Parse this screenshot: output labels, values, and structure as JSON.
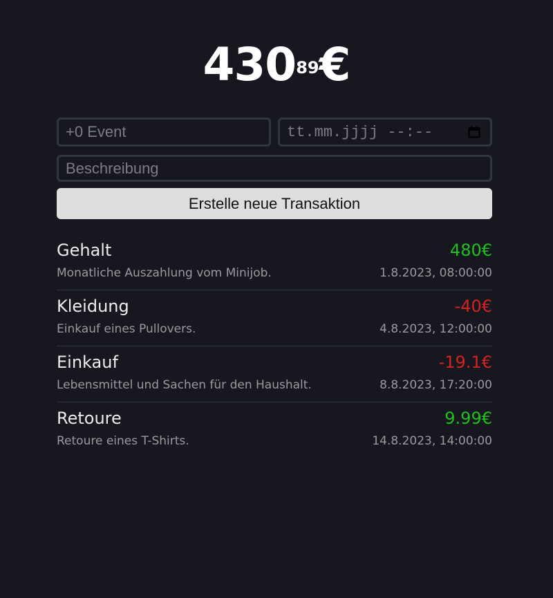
{
  "balance": {
    "whole": "430",
    "cents": "89",
    "currency": "€"
  },
  "form": {
    "amount_placeholder": "+0 Event",
    "date_placeholder": "tt.mm.jjjj --:--",
    "description_placeholder": "Beschreibung",
    "submit_label": "Erstelle neue Transaktion",
    "date_icon": "calendar-icon"
  },
  "colors": {
    "background": "#17181f",
    "positive": "#20c020",
    "negative": "#d42222",
    "button": "#dedede"
  },
  "transactions": [
    {
      "title": "Gehalt",
      "amount": "480€",
      "sign": "positive",
      "description": "Monatliche Auszahlung vom Minijob.",
      "date": "1.8.2023, 08:00:00"
    },
    {
      "title": "Kleidung",
      "amount": "-40€",
      "sign": "negative",
      "description": "Einkauf eines Pullovers.",
      "date": "4.8.2023, 12:00:00"
    },
    {
      "title": "Einkauf",
      "amount": "-19.1€",
      "sign": "negative",
      "description": "Lebensmittel und Sachen für den Haushalt.",
      "date": "8.8.2023, 17:20:00"
    },
    {
      "title": "Retoure",
      "amount": "9.99€",
      "sign": "positive",
      "description": "Retoure eines T-Shirts.",
      "date": "14.8.2023, 14:00:00"
    }
  ]
}
